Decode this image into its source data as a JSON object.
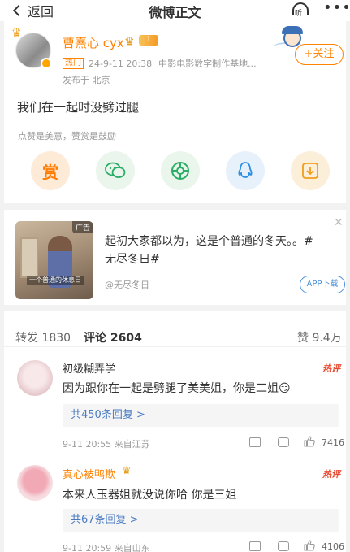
{
  "header": {
    "back_label": "返回",
    "title": "微博正文",
    "listen_label": "听"
  },
  "post": {
    "username": "曹熹心 cyx",
    "level_badge": "1",
    "hot_badge": "热门",
    "timestamp": "24-9-11 20:38",
    "source": "中影电影数字制作基地...",
    "published_from": "发布于 北京",
    "follow_label": "+关注",
    "content": "我们在一起时没劈过腿",
    "tip": "点赞是美意，赞赏是鼓励",
    "reward_label": "赏"
  },
  "ad": {
    "tag": "广告",
    "image_caption": "一个普通的休息日",
    "text": "起初大家都以为，这是个普通的冬天。。#无尽冬日#",
    "source": "@无尽冬日",
    "app_download": "APP下载"
  },
  "tabs": {
    "repost": "转发 1830",
    "comments": "评论 2604",
    "likes": "赞 9.4万"
  },
  "comments": [
    {
      "username": "初级糊弄学",
      "hot_tag": "热评",
      "text": "因为跟你在一起是劈腿了美美姐，你是二姐😏",
      "replies": "共450条回复 >",
      "meta": "9-11 20:55  来自江苏",
      "likes": "7416"
    },
    {
      "username": "真心被鸭欺",
      "hot_tag": "热评",
      "text": "本来人玉器姐就没说你哈 你是三姐",
      "replies": "共67条回复 >",
      "meta": "9-11 20:59  来自山东",
      "likes": "4106"
    }
  ],
  "colors": {
    "brand_orange": "#ff8200",
    "link_blue": "#4a7bc2",
    "hot_red": "#e84a2f"
  }
}
